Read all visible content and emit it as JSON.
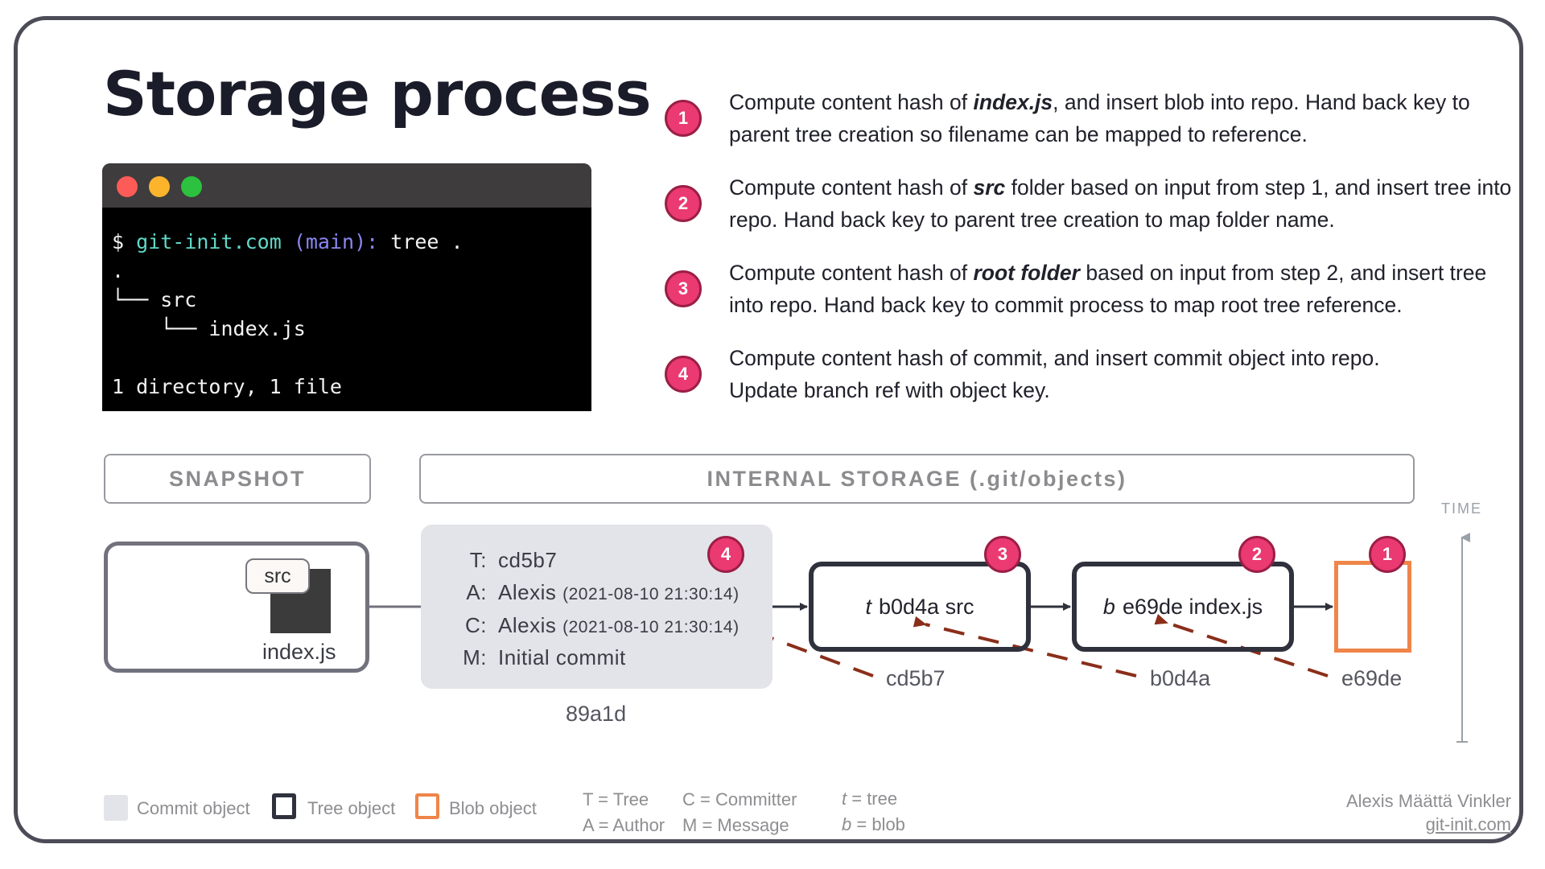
{
  "title": "Storage process",
  "terminal": {
    "prompt": "$",
    "host": "git-init.com",
    "branch": "(main):",
    "command": "tree .",
    "output": [
      ".",
      "└── src",
      "    └── index.js",
      "",
      "1 directory, 1 file"
    ],
    "dots": [
      "#fd5b57",
      "#fdb42d",
      "#2cc13e"
    ]
  },
  "steps": [
    {
      "n": "1",
      "pre": "Compute content hash of ",
      "em": "index.js",
      "post": ", and insert blob into repo. Hand back key to parent tree creation so filename can be mapped to reference."
    },
    {
      "n": "2",
      "pre": "Compute content hash of ",
      "em": "src",
      "post": " folder based on input from step 1, and insert tree into repo. Hand back key to parent tree creation to map folder name."
    },
    {
      "n": "3",
      "pre": "Compute content hash of ",
      "em": "root folder",
      "post": " based on input from step 2, and insert tree into repo. Hand back key to commit process to map root tree reference."
    },
    {
      "n": "4",
      "pre": "Compute content hash of commit, and insert commit object into repo. Update branch ref with object key.",
      "em": "",
      "post": ""
    }
  ],
  "headers": {
    "snapshot": "SNAPSHOT",
    "storage": "INTERNAL STORAGE (.git/objects)"
  },
  "snapshot": {
    "folder": "src",
    "file": "index.js"
  },
  "commit": {
    "badge": "4",
    "rows": [
      {
        "key": "T:",
        "value": "cd5b7",
        "extra": ""
      },
      {
        "key": "A:",
        "value": "Alexis",
        "extra": "(2021-08-10 21:30:14)"
      },
      {
        "key": "C:",
        "value": "Alexis",
        "extra": "(2021-08-10 21:30:14)"
      },
      {
        "key": "M:",
        "value": "Initial commit",
        "extra": ""
      }
    ],
    "hash": "89a1d"
  },
  "objects": [
    {
      "type": "t",
      "hash": "b0d4a",
      "name": "src",
      "badge": "3",
      "key": "cd5b7"
    },
    {
      "type": "b",
      "hash": "e69de",
      "name": "index.js",
      "badge": "2",
      "key": "b0d4a"
    },
    {
      "type": "blob",
      "badge": "1",
      "key": "e69de"
    }
  ],
  "time_label": "TIME",
  "legend": {
    "commit": "Commit object",
    "tree": "Tree object",
    "blob": "Blob object",
    "abbr": [
      "T = Tree",
      "A = Author",
      "C = Committer",
      "M = Message"
    ],
    "t": "t",
    "t_eq": " = tree",
    "b": "b",
    "b_eq": " = blob"
  },
  "credit": {
    "author": "Alexis Määttä Vinkler",
    "site": "git-init.com"
  },
  "colors": {
    "badge": "#ea3a71",
    "tree_border": "#2f313c",
    "blob_border": "#ef8549",
    "commit_bg": "#e3e4e9",
    "arrow_dash": "#8a2e1a"
  }
}
